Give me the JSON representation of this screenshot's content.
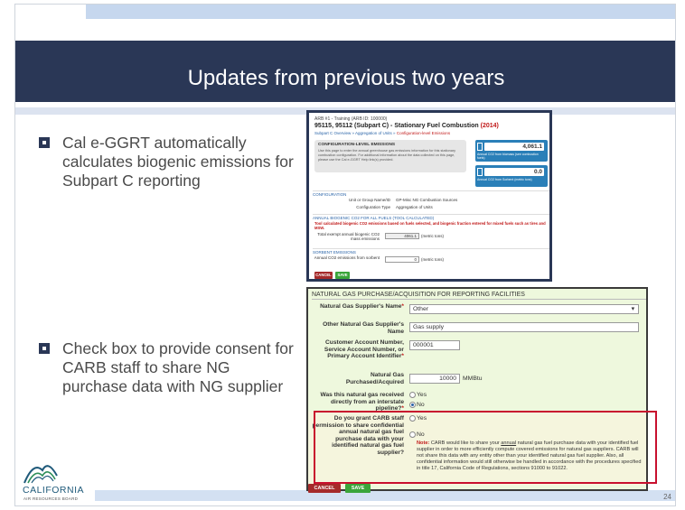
{
  "slide": {
    "title": "Updates from previous two years",
    "page_number": "24"
  },
  "bullets": [
    "Cal e-GGRT automatically calculates biogenic emissions for Subpart C reporting",
    "Check box to provide consent for CARB staff to share NG purchase data with NG supplier"
  ],
  "logo": {
    "wordmark": "CALIFORNIA",
    "subtitle": "AIR RESOURCES BOARD"
  },
  "screenshot1": {
    "breadcrumb": "ARB #1 - Training (ARB ID: 100000)",
    "title_main": "95115, 95112 (Subpart C) - Stationary Fuel Combustion",
    "title_year": "(2014)",
    "subnav_a": "Subpart C Overview » Aggregation of Units »",
    "subnav_b": "Configuration-level Emissions",
    "box_heading": "CONFIGURATION-LEVEL EMISSIONS",
    "box_text": "Use this page to enter the annual greenhouse gas emissions information for this stationary combustion configuration. For additional information about the data collected on this page, please use the Cal e-GGRT Help link(s) provided.",
    "stat1_value": "4,061.1",
    "stat1_label": "Annual CO2 from biomass (see combustion fuels)",
    "stat2_value": "0.0",
    "stat2_label": "Annual CO2 from Sorbent (metric tons)",
    "configuration_heading": "CONFIGURATION",
    "unit_label": "Unit or Group Name/ID",
    "unit_value": "GP-Misc NG Combustion Sources",
    "config_type_label": "Configuration Type",
    "config_type_value": "Aggregation of Units",
    "biogenic_heading": "ANNUAL BIOGENIC CO2 FOR ALL FUELS (TOOL CALCULATED)",
    "biogenic_note": "Tool calculated biogenic CO2 emissions based on fuels selected, and biogenic fraction entered for mixed fuels such as tires and MSW.",
    "biogenic_total_label": "Total exempt annual biogenic CO2 mass emissions",
    "biogenic_total_value": "4061.1",
    "biogenic_unit": "(metric tons)",
    "sorbent_heading": "SORBENT EMISSIONS",
    "sorbent_label": "Annual CO2 emissions from sorbent",
    "sorbent_value": "0",
    "sorbent_unit": "(metric tons)",
    "cancel_label": "CANCEL",
    "save_label": "SAVE"
  },
  "screenshot2": {
    "heading": "NATURAL GAS PURCHASE/ACQUISITION FOR REPORTING FACILITIES",
    "supplier_name_label": "Natural Gas Supplier's Name",
    "supplier_name_value": "Other",
    "other_supplier_label": "Other Natural Gas Supplier's Name",
    "other_supplier_value": "Gas supply",
    "account_label": "Customer Account Number, Service Account Number, or Primary Account Identifier",
    "account_value": "000001",
    "purchased_label": "Natural Gas Purchased/Acquired",
    "purchased_value": "10000",
    "purchased_unit": "MMBtu",
    "interstate_label": "Was this natural gas received directly from an interstate pipeline?",
    "interstate_options": [
      "Yes",
      "No"
    ],
    "interstate_selected": "No",
    "consent_label": "Do you grant CARB staff permission to share confidential annual natural gas fuel purchase data with your identified natural gas fuel supplier?",
    "consent_options": [
      "Yes",
      "No"
    ],
    "note_label": "Note:",
    "note_text_a": "CARB would like to share your",
    "note_underlined": "annual",
    "note_text_b": "natural gas fuel purchase data with your identified fuel supplier in order to more efficiently compute covered emissions for natural gas suppliers. CARB will not share this data with any entity other than your identified natural gas fuel supplier. Also, all confidential information would still otherwise be handled in accordance with the procedures specified in title 17, California Code of Regulations, sections 91000 to 91022.",
    "cancel_label": "CANCEL",
    "save_label": "SAVE"
  },
  "colors": {
    "title_band": "#2a3756",
    "accent_red": "#c8102e",
    "save_green": "#3aa53a",
    "cancel_red": "#a52a2a",
    "form_bg": "#eef8dd"
  }
}
